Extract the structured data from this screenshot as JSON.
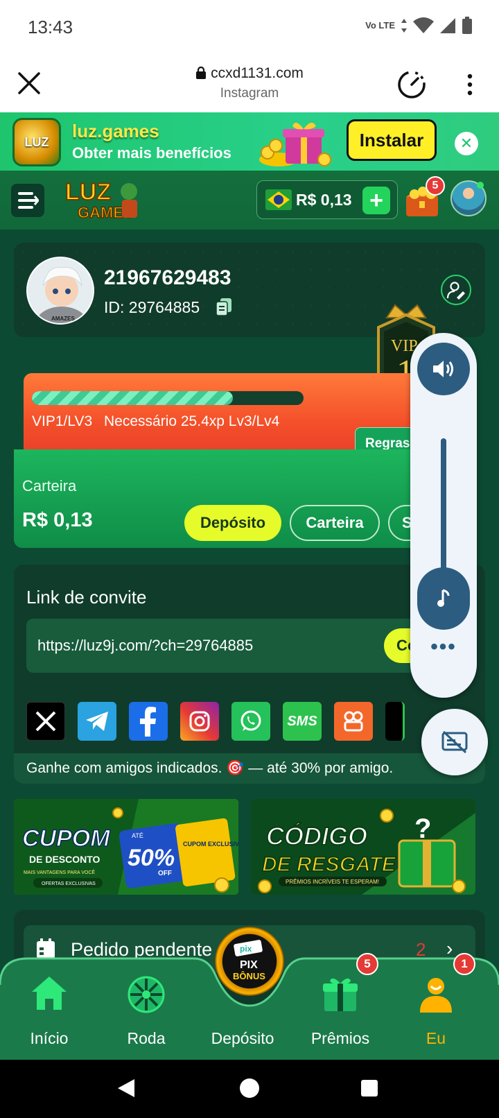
{
  "status_bar": {
    "time": "13:43",
    "network": "Vo LTE"
  },
  "browser": {
    "url": "ccxd1131.com",
    "source": "Instagram"
  },
  "install_banner": {
    "app_name": "luz.games",
    "subtitle": "Obter mais benefícios",
    "install_label": "Instalar",
    "logo_text": "LUZ"
  },
  "header": {
    "logo_text": "LUZ",
    "logo_sub": "GAMES",
    "balance": "R$ 0,13",
    "chest_badge": "5"
  },
  "profile": {
    "username": "21967629483",
    "id_label": "ID: 29764885",
    "avatar_caption": "AMAZES"
  },
  "vip": {
    "badge_text": "VIP",
    "badge_level": "1",
    "progress_fraction": 0.74,
    "level": "VIP1/LV3",
    "requirement": "Necessário 25.4xp Lv3/Lv4",
    "rules_label": "Regras"
  },
  "wallet": {
    "label": "Carteira",
    "amount": "R$ 0,13",
    "deposit_label": "Depósito",
    "wallet_label": "Carteira",
    "withdraw_label": "S"
  },
  "invite": {
    "title": "Link de convite",
    "link": "https://luz9j.com/?ch=29764885",
    "copy_label": "Copiar",
    "share": [
      "X",
      "Telegram",
      "Facebook",
      "Instagram",
      "WhatsApp",
      "SMS",
      "Kwai"
    ],
    "sms_text": "SMS",
    "note": "Ganhe com amigos indicados. 🎯 — até 30% por amigo."
  },
  "promos": {
    "coupon_title": "CUPOM",
    "coupon_sub": "DE DESCONTO",
    "coupon_percent": "50%",
    "coupon_off": "OFF",
    "coupon_until": "ATÉ",
    "coupon_exclusive": "CUPOM EXCLUSIVO",
    "coupon_more": "MAIS VANTAGENS PARA VOCÊ",
    "coupon_offers": "OFERTAS EXCLUSIVAS",
    "code_title": "CÓDIGO",
    "code_sub": "DE RESGATE",
    "code_note": "PRÊMIOS INCRÍVEIS TE ESPERAM!"
  },
  "pending": {
    "label": "Pedido pendente",
    "count": "2"
  },
  "bottom_nav": {
    "items": [
      {
        "label": "Início"
      },
      {
        "label": "Roda"
      },
      {
        "label": "Depósito"
      },
      {
        "label": "Prêmios",
        "badge": "5"
      },
      {
        "label": "Eu",
        "badge": "1"
      }
    ],
    "pix_text": "PIX",
    "pix_sub": "BÔNUS",
    "pix_tag": "pix"
  },
  "colors": {
    "accent_yellow": "#e6fb2a",
    "green": "#1db55d",
    "badge_red": "#e53935",
    "active_nav": "#ffb300"
  }
}
